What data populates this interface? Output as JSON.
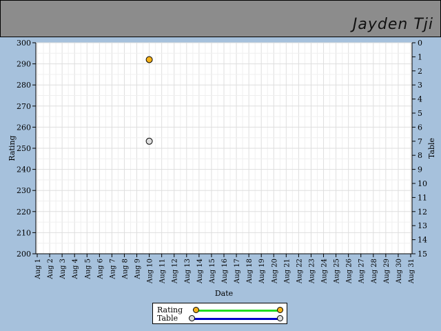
{
  "header": {
    "name": "Jayden Tji"
  },
  "colors": {
    "rating_marker": "#f5b21a",
    "table_marker": "#dcdcdc",
    "rating_line": "#22dd22",
    "table_line": "#0000cc",
    "background": "#a6c1dc",
    "header_bg": "#8c8c8c"
  },
  "chart_data": {
    "type": "scatter",
    "xlabel": "Date",
    "ylabel": "Rating",
    "y2label": "Table",
    "x_categories": [
      "Aug 1",
      "Aug 2",
      "Aug 3",
      "Aug 4",
      "Aug 5",
      "Aug 6",
      "Aug 7",
      "Aug 8",
      "Aug 9",
      "Aug 10",
      "Aug 11",
      "Aug 12",
      "Aug 13",
      "Aug 14",
      "Aug 15",
      "Aug 16",
      "Aug 17",
      "Aug 18",
      "Aug 19",
      "Aug 20",
      "Aug 21",
      "Aug 22",
      "Aug 23",
      "Aug 24",
      "Aug 25",
      "Aug 26",
      "Aug 27",
      "Aug 28",
      "Aug 29",
      "Aug 30",
      "Aug 31"
    ],
    "ylim": [
      200,
      300
    ],
    "yticks": [
      200,
      210,
      220,
      230,
      240,
      250,
      260,
      270,
      280,
      290,
      300
    ],
    "y2lim": [
      15,
      0
    ],
    "y2ticks": [
      0,
      1,
      2,
      3,
      4,
      5,
      6,
      7,
      8,
      9,
      10,
      11,
      12,
      13,
      14,
      15
    ],
    "grid": true,
    "series": [
      {
        "name": "Rating",
        "axis": "left",
        "points": [
          {
            "x": "Aug 10",
            "y": 292
          }
        ]
      },
      {
        "name": "Table",
        "axis": "right",
        "points": [
          {
            "x": "Aug 10",
            "y": 7
          }
        ]
      }
    ],
    "legend": "bottom"
  }
}
